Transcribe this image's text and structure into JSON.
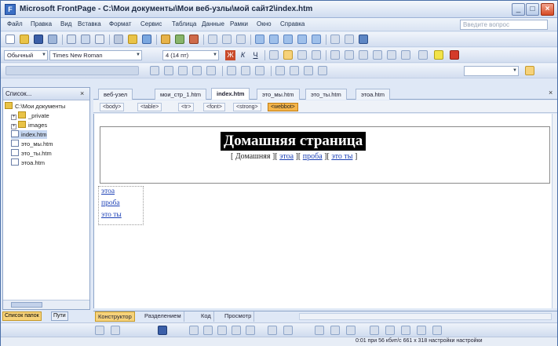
{
  "window": {
    "title": "Microsoft FrontPage - C:\\Мои документы\\Мои веб-узлы\\мой сайт2\\index.htm",
    "icon_letter": "F",
    "minimize_icon": "minimize-icon",
    "maximize_icon": "maximize-icon",
    "close_icon": "close-icon"
  },
  "menu": {
    "items": [
      "Файл",
      "Правка",
      "Вид",
      "Вставка",
      "Формат",
      "Сервис",
      "Таблица",
      "Данные",
      "Рамки",
      "Окно",
      "Справка"
    ],
    "help_placeholder": "Введите вопрос"
  },
  "formatting": {
    "style": "Обычный",
    "font": "Times New Roman",
    "size": "4 (14 пт)",
    "buttons": [
      "Ж",
      "К",
      "Ч"
    ]
  },
  "folder_list": {
    "title": "Список...",
    "close": "×",
    "items": [
      {
        "label": "C:\\Мои документы",
        "type": "folder",
        "expander": "",
        "level": 0
      },
      {
        "label": "_private",
        "type": "folder",
        "expander": "+",
        "level": 1
      },
      {
        "label": "images",
        "type": "folder",
        "expander": "+",
        "level": 1
      },
      {
        "label": "index.htm",
        "type": "page",
        "expander": "",
        "level": 1,
        "selected": true
      },
      {
        "label": "это_мы.htm",
        "type": "page",
        "expander": "",
        "level": 1
      },
      {
        "label": "это_ты.htm",
        "type": "page",
        "expander": "",
        "level": 1
      },
      {
        "label": "этоа.htm",
        "type": "page",
        "expander": "",
        "level": 1
      }
    ],
    "bottom_tabs": [
      "Список папок",
      "Пути"
    ]
  },
  "document_tabs": [
    "веб-узел",
    "мои_стр_1.htm",
    "index.htm",
    "это_мы.htm",
    "это_ты.htm",
    "этоа.htm"
  ],
  "document_close": "×",
  "tag_selector": [
    "<body>",
    "<table>",
    "<tr>",
    "<font>",
    "<strong>",
    "<webbot>"
  ],
  "page": {
    "title": "Домашняя страница",
    "nav_open": "[ ",
    "nav_sep": " ][ ",
    "nav_close": " ]",
    "nav_items": [
      "Домашняя",
      "этоа",
      "проба",
      "это ты"
    ],
    "side_links": [
      "этоа",
      "проба",
      "это ты"
    ]
  },
  "view_tabs": [
    "Конструктор",
    "Разделением",
    "Код",
    "Просмотр"
  ],
  "status": "0:01 при 56 кбит/с   661 x 318   настройки   настройки",
  "colors": {
    "accent": "#f6d27a",
    "title_bg": "#000000",
    "link": "#1a3fb5"
  }
}
